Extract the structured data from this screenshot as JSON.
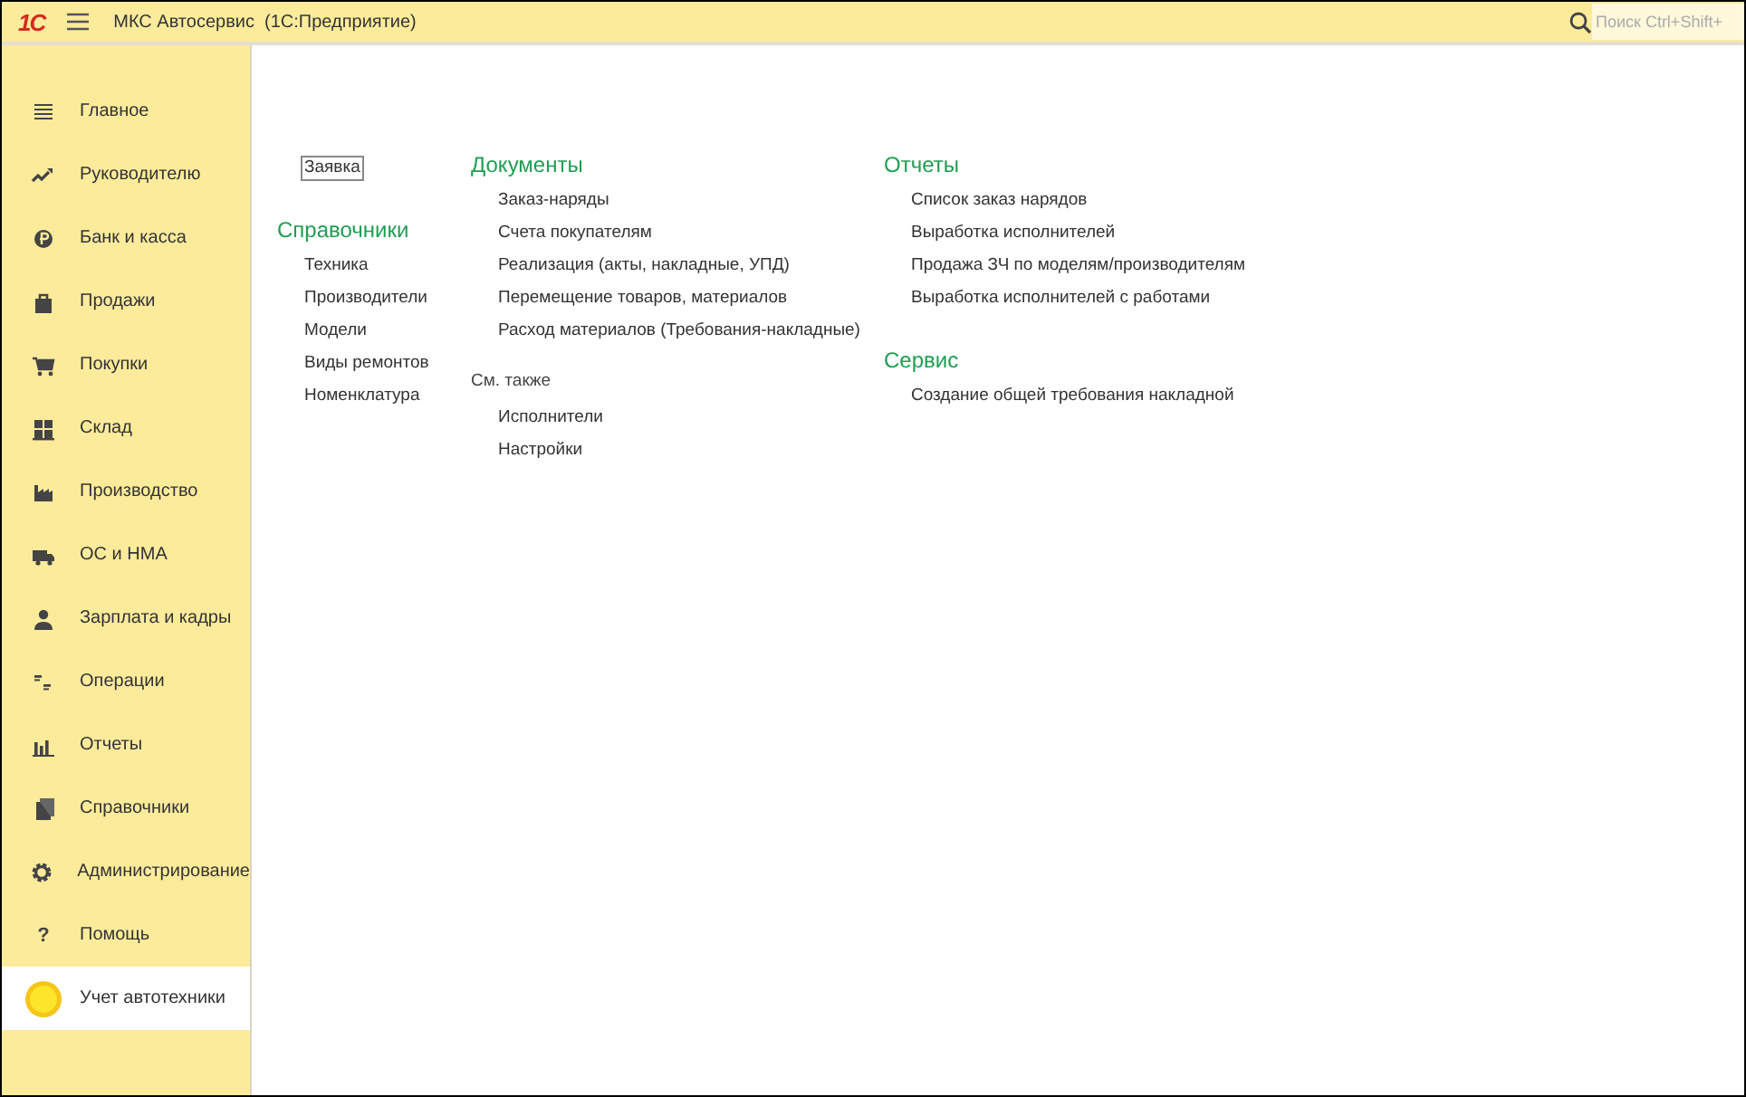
{
  "window": {
    "logo": "1С",
    "title": "МКС Автосервис  (1С:Предприятие)"
  },
  "search": {
    "placeholder": "Поиск Ctrl+Shift+"
  },
  "sidebar": {
    "items": [
      {
        "kind": "menu",
        "label": "Главное",
        "selected": false
      },
      {
        "kind": "trend",
        "label": "Руководителю",
        "selected": false
      },
      {
        "kind": "coin",
        "label": "Банк и касса",
        "selected": false
      },
      {
        "kind": "bag",
        "label": "Продажи",
        "selected": false
      },
      {
        "kind": "cart",
        "label": "Покупки",
        "selected": false
      },
      {
        "kind": "warehouse",
        "label": "Склад",
        "selected": false
      },
      {
        "kind": "factory",
        "label": "Производство",
        "selected": false
      },
      {
        "kind": "truck",
        "label": "ОС и НМА",
        "selected": false
      },
      {
        "kind": "person",
        "label": "Зарплата и кадры",
        "selected": false
      },
      {
        "kind": "ledger",
        "label": "Операции",
        "selected": false
      },
      {
        "kind": "chart",
        "label": "Отчеты",
        "selected": false
      },
      {
        "kind": "books",
        "label": "Справочники",
        "selected": false
      },
      {
        "kind": "gear",
        "label": "Администрирование",
        "selected": false
      },
      {
        "kind": "help",
        "glyph": "?",
        "label": "Помощь",
        "selected": false
      },
      {
        "kind": "sun",
        "label": "Учет автотехники",
        "selected": true
      }
    ]
  },
  "columns": [
    {
      "groups": [
        {
          "items": [
            {
              "label": "Заявка",
              "focused": true
            }
          ]
        },
        {
          "kind": "section",
          "title": "Справочники",
          "items": [
            {
              "label": "Техника",
              "focused": false
            },
            {
              "label": "Производители",
              "focused": false
            },
            {
              "label": "Модели",
              "focused": false
            },
            {
              "label": "Виды ремонтов",
              "focused": false
            },
            {
              "label": "Номенклатура",
              "focused": false
            }
          ]
        }
      ]
    },
    {
      "groups": [
        {
          "kind": "section",
          "title": "Документы",
          "items": [
            {
              "label": "Заказ-наряды",
              "focused": false
            },
            {
              "label": "Счета покупателям",
              "focused": false
            },
            {
              "label": "Реализация (акты, накладные, УПД)",
              "focused": false
            },
            {
              "label": "Перемещение товаров, материалов",
              "focused": false
            },
            {
              "label": "Расход материалов (Требования-накладные)",
              "focused": false
            }
          ]
        },
        {
          "kind": "see_also",
          "title": "См. также",
          "items": [
            {
              "label": "Исполнители",
              "focused": false
            },
            {
              "label": "Настройки",
              "focused": false
            }
          ]
        }
      ]
    },
    {
      "groups": [
        {
          "kind": "section",
          "title": "Отчеты",
          "items": [
            {
              "label": "Список заказ нарядов",
              "focused": false
            },
            {
              "label": "Выработка исполнителей",
              "focused": false
            },
            {
              "label": "Продажа ЗЧ по моделям/производителям",
              "focused": false
            },
            {
              "label": "Выработка исполнителей с работами",
              "focused": false
            }
          ]
        },
        {
          "kind": "section",
          "title": "Сервис",
          "items": [
            {
              "label": "Создание общей требования накладной",
              "focused": false
            }
          ]
        }
      ]
    }
  ]
}
